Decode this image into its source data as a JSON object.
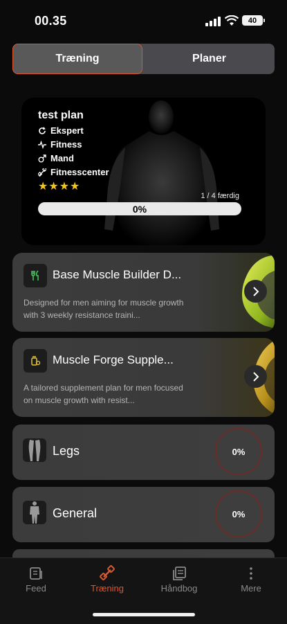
{
  "status": {
    "time": "00.35",
    "battery": "40"
  },
  "segment": {
    "tabs": [
      "Træning",
      "Planer"
    ],
    "active": 0
  },
  "hero": {
    "title": "test plan",
    "attributes": [
      {
        "icon": "refresh-icon",
        "label": "Ekspert"
      },
      {
        "icon": "pulse-icon",
        "label": "Fitness"
      },
      {
        "icon": "male-icon",
        "label": "Mand"
      },
      {
        "icon": "dumbbell-icon",
        "label": "Fitnesscenter"
      }
    ],
    "stars": "★★★★",
    "rating": 4,
    "progress_text": "1 / 4 færdig",
    "progress_percent": 0,
    "progress_label": "0%"
  },
  "cards": {
    "diet": {
      "icon": "utensils-icon",
      "title": "Base Muscle Builder D...",
      "desc": "Designed for men aiming for muscle growth with 3 weekly resistance traini..."
    },
    "supplement": {
      "icon": "pill-bottle-icon",
      "title": "Muscle Forge Supple...",
      "desc": "A tailored supplement plan for men focused on muscle growth with resist..."
    }
  },
  "workouts": [
    {
      "title": "Legs",
      "progress": "0%"
    },
    {
      "title": "General",
      "progress": "0%"
    }
  ],
  "tabbar": {
    "items": [
      {
        "label": "Feed",
        "icon": "feed-icon"
      },
      {
        "label": "Træning",
        "icon": "dumbbell-icon"
      },
      {
        "label": "Håndbog",
        "icon": "book-icon"
      },
      {
        "label": "Mere",
        "icon": "more-icon"
      }
    ],
    "active": 1
  },
  "colors": {
    "accent": "#e4552a",
    "star": "#f4c51d",
    "ring": "#6b2d28"
  }
}
